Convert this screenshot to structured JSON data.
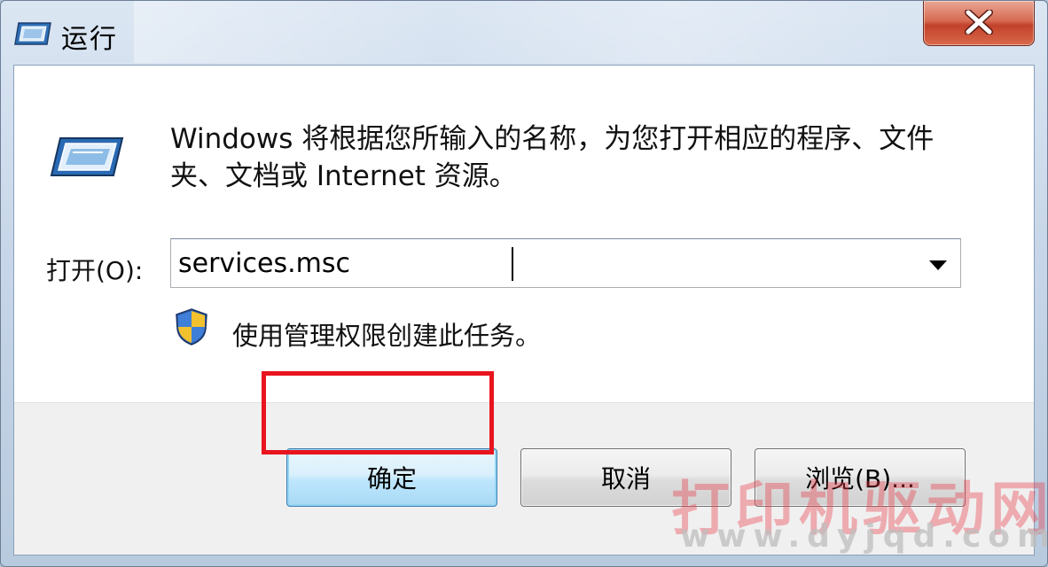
{
  "window": {
    "title": "运行",
    "close_symbol": "X"
  },
  "icons": {
    "title": "run-icon",
    "main": "run-icon",
    "admin": "uac-shield-icon",
    "dropdown": "chevron-down-icon"
  },
  "dialog": {
    "description": "Windows 将根据您所输入的名称，为您打开相应的程序、文件夹、文档或 Internet 资源。",
    "open_label": "打开(O):",
    "open_value": "services.msc",
    "admin_note": "使用管理权限创建此任务。"
  },
  "buttons": {
    "ok": "确定",
    "cancel": "取消",
    "browse": "浏览(B)..."
  },
  "watermark": {
    "text": "打印机驱动网",
    "url": "www.dyjqd.com"
  },
  "colors": {
    "highlight": "#e8141e",
    "close_button": "#c2412a",
    "default_button": "#bee6fd"
  }
}
